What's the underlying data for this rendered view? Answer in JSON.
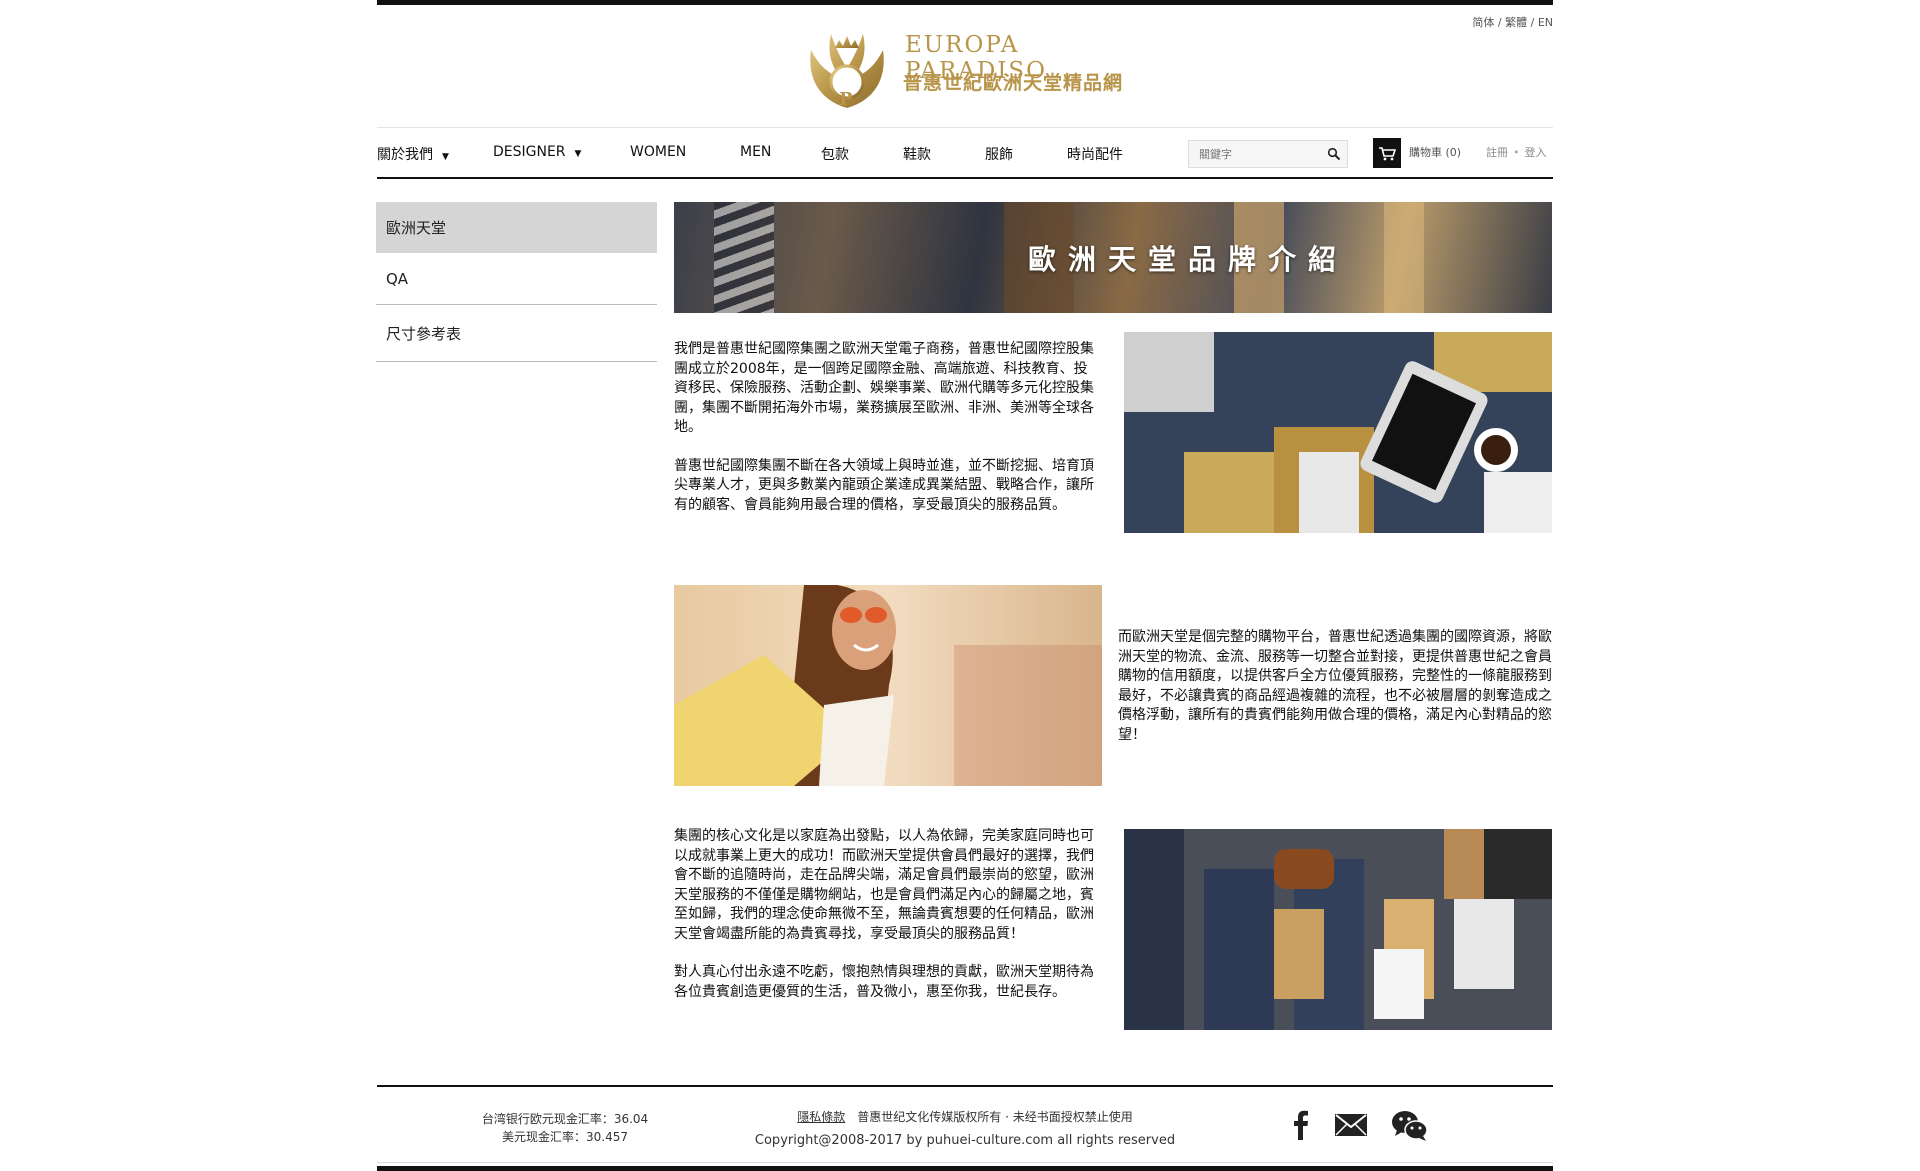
{
  "languages": [
    "简体",
    "繁體",
    "EN"
  ],
  "brand": {
    "name_en": "EUROPA PARADISO",
    "name_zh": "普惠世紀歐洲天堂精品網",
    "emblem_letter": "P"
  },
  "nav": {
    "items": [
      {
        "label": "關於我們",
        "has_dropdown": true
      },
      {
        "label": "DESIGNER",
        "has_dropdown": true
      },
      {
        "label": "WOMEN"
      },
      {
        "label": "MEN"
      },
      {
        "label": "包款"
      },
      {
        "label": "鞋款"
      },
      {
        "label": "服飾"
      },
      {
        "label": "時尚配件"
      }
    ],
    "search_placeholder": "關鍵字",
    "cart_label": "購物車 (0)",
    "register": "註冊",
    "login": "登入"
  },
  "sidebar": {
    "items": [
      {
        "label": "歐洲天堂",
        "active": true
      },
      {
        "label": "QA"
      },
      {
        "label": "尺寸參考表"
      }
    ]
  },
  "hero": {
    "title": "歐洲天堂品牌介紹"
  },
  "content": {
    "block1": [
      "我們是普惠世紀國際集團之歐洲天堂電子商務，普惠世紀國際控股集團成立於2008年，是一個跨足國際金融、高端旅遊、科技教育、投資移民、保險服務、活動企劃、娛樂事業、歐洲代購等多元化控股集團，集團不斷開拓海外市場，業務擴展至歐洲、非洲、美洲等全球各地。",
      "普惠世紀國際集團不斷在各大領域上與時並進，並不斷挖掘、培育頂尖專業人才，更與多數業內龍頭企業達成異業結盟、戰略合作，讓所有的顧客、會員能夠用最合理的價格，享受最頂尖的服務品質。"
    ],
    "block2": [
      "而歐洲天堂是個完整的購物平台，普惠世紀透過集團的國際資源，將歐洲天堂的物流、金流、服務等一切整合並對接，更提供普惠世紀之會員購物的信用額度，以提供客戶全方位優質服務，完整性的一條龍服務到最好，不必讓貴賓的商品經過複雜的流程，也不必被層層的剝奪造成之價格浮動，讓所有的貴賓們能夠用做合理的價格，滿足內心對精品的慾望！"
    ],
    "block3": [
      "集團的核心文化是以家庭為出發點，以人為依歸，完美家庭同時也可以成就事業上更大的成功！而歐洲天堂提供會員們最好的選擇，我們會不斷的追隨時尚，走在品牌尖端，滿足會員們最崇尚的慾望，歐洲天堂服務的不僅僅是購物網站，也是會員們滿足內心的歸屬之地，賓至如歸，我們的理念使命無微不至，無論貴賓想要的任何精品，歐洲天堂會竭盡所能的為貴賓尋找，享受最頂尖的服務品質！",
      "對人真心付出永遠不吃虧，懷抱熱情與理想的貢獻，歐洲天堂期待為各位貴賓創造更優質的生活，普及微小，惠至你我，世紀長存。"
    ]
  },
  "footer": {
    "rate_eur": "台湾银行欧元现金汇率：36.04",
    "rate_usd": "美元现金汇率：30.457",
    "privacy": "隱私條款",
    "rights": "普惠世纪文化传媒版权所有 · 未经书面授权禁止使用",
    "copyright": "Copyright@2008-2017 by puhuei-culture.com all rights reserved",
    "social": [
      "facebook-icon",
      "mail-icon",
      "wechat-icon"
    ]
  },
  "colors": {
    "gold": "#b8954a",
    "dark": "#111111",
    "sidebar_active": "#d5d5d5"
  }
}
